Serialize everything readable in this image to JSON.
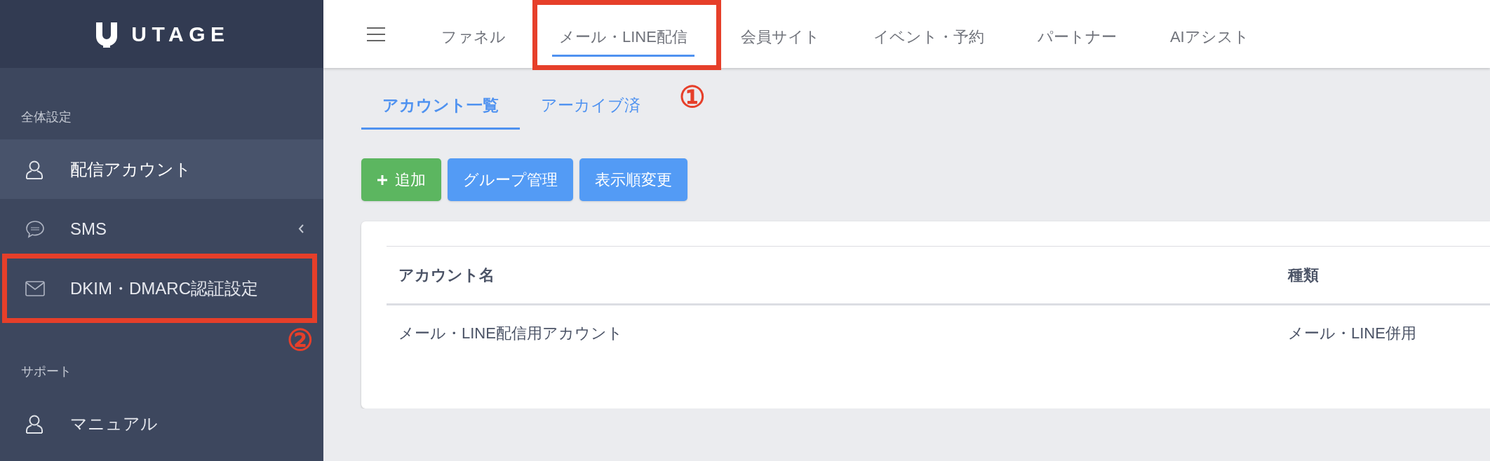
{
  "logo_text": "UTAGE",
  "top_nav": [
    {
      "label": "ファネル",
      "selected": false
    },
    {
      "label": "メール・LINE配信",
      "selected": true,
      "annotation": "①"
    },
    {
      "label": "会員サイト",
      "selected": false
    },
    {
      "label": "イベント・予約",
      "selected": false
    },
    {
      "label": "パートナー",
      "selected": false
    },
    {
      "label": "AIアシスト",
      "selected": false
    }
  ],
  "sidebar": [
    {
      "title": "全体設定",
      "items": [
        {
          "label": "配信アカウント",
          "kind": "person",
          "selected": true
        },
        {
          "label": "SMS",
          "kind": "sms",
          "selected": false,
          "has_submenu": true
        },
        {
          "label": "DKIM・DMARC認証設定",
          "kind": "mail",
          "selected": false,
          "annotation": "②"
        }
      ]
    },
    {
      "title": "サポート",
      "items": [
        {
          "label": "マニュアル",
          "kind": "person",
          "selected": false
        }
      ]
    }
  ],
  "sub_tabs": [
    {
      "label": "アカウント一覧",
      "selected": true
    },
    {
      "label": "アーカイブ済",
      "selected": false
    }
  ],
  "buttons": [
    {
      "label": "追加",
      "kind": "add"
    },
    {
      "label": "グループ管理",
      "kind": "primary"
    },
    {
      "label": "表示順変更",
      "kind": "primary"
    }
  ],
  "table": {
    "columns": [
      "アカウント名",
      "種類"
    ],
    "rows": [
      [
        "メール・LINE配信用アカウント",
        "メール・LINE併用"
      ]
    ]
  }
}
